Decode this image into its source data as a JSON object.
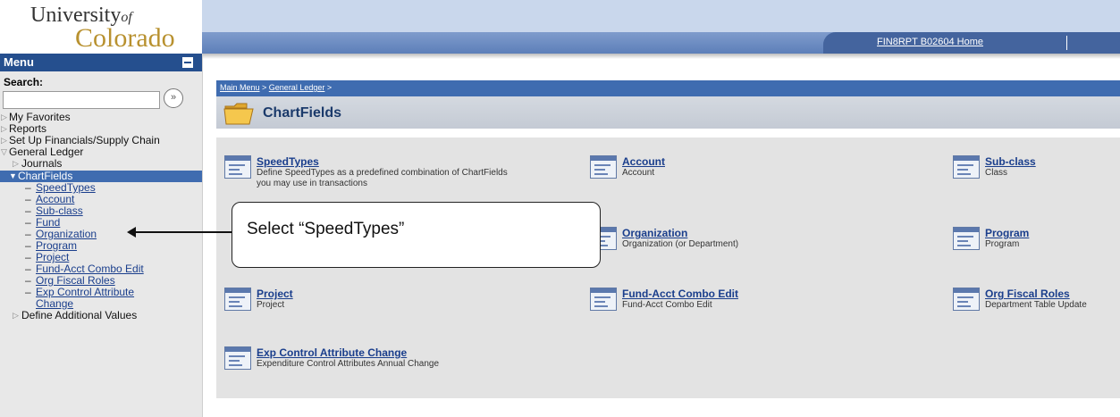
{
  "logo": {
    "line1": "University",
    "line1b": "of",
    "line2": "Colorado"
  },
  "header": {
    "home_link": "FIN8RPT B02604 Home"
  },
  "menu": {
    "title": "Menu",
    "search_label": "Search:",
    "search_value": "",
    "items": [
      {
        "label": "My Favorites"
      },
      {
        "label": "Reports"
      },
      {
        "label": "Set Up Financials/Supply Chain"
      },
      {
        "label": "General Ledger"
      },
      {
        "label": "Journals"
      },
      {
        "label": "ChartFields"
      }
    ],
    "chartfield_links": [
      "SpeedTypes",
      "Account",
      "Sub-class",
      "Fund",
      "Organization",
      "Program",
      "Project",
      "Fund-Acct Combo Edit",
      "Org Fiscal Roles",
      "Exp Control Attribute Change"
    ],
    "last_item": "Define Additional Values"
  },
  "breadcrumb": {
    "main_menu": "Main Menu",
    "sep1": " > ",
    "general_ledger": "General Ledger",
    "sep2": " >"
  },
  "page_title": "ChartFields",
  "tiles": [
    {
      "name": "SpeedTypes",
      "desc": "Define SpeedTypes as a predefined combination of ChartFields",
      "desc2": "you may use in transactions"
    },
    {
      "name": "Account",
      "desc": "Account"
    },
    {
      "name": "Sub-class",
      "desc": "Class"
    },
    {
      "name": "Organization",
      "desc": "Organization (or Department)"
    },
    {
      "name": "Program",
      "desc": "Program"
    },
    {
      "name": "Project",
      "desc": "Project"
    },
    {
      "name": "Fund-Acct Combo Edit",
      "desc": "Fund-Acct Combo Edit"
    },
    {
      "name": "Org Fiscal Roles",
      "desc": "Department Table Update"
    },
    {
      "name": "Exp Control Attribute Change",
      "desc": "Expenditure Control Attributes Annual Change"
    }
  ],
  "callout": {
    "text": "Select “SpeedTypes”"
  }
}
